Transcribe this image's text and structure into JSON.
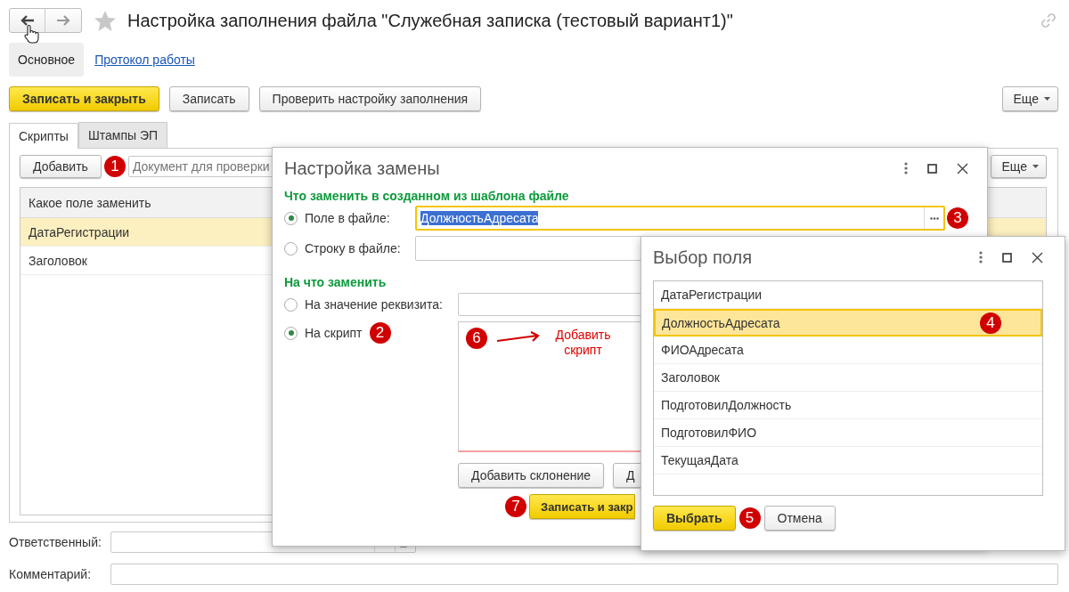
{
  "window": {
    "title": "Настройка заполнения файла \"Служебная записка (тестовый вариант1)\""
  },
  "sections": [
    {
      "label": "Основное",
      "selected": true
    },
    {
      "label": "Протокол работы",
      "selected": false
    }
  ],
  "command_bar": {
    "buttons": [
      {
        "label": "Записать и закрыть",
        "kind": "primary"
      },
      {
        "label": "Записать",
        "kind": "normal"
      },
      {
        "label": "Проверить настройку заполнения",
        "kind": "normal"
      }
    ],
    "more": "Еще"
  },
  "tabs": [
    {
      "label": "Скрипты",
      "selected": true
    },
    {
      "label": "Штампы ЭП",
      "selected": false
    }
  ],
  "scripts_toolbar": {
    "add_button": "Добавить",
    "callout": "1",
    "document_field": {
      "placeholder": "Документ для проверки"
    },
    "more": "Еще"
  },
  "scripts_table": {
    "columns": [
      "Какое поле заменить"
    ],
    "rows": [
      {
        "cells": [
          "ДатаРегистрации"
        ],
        "selected": true
      },
      {
        "cells": [
          "Заголовок"
        ],
        "selected": false
      }
    ]
  },
  "responsible": {
    "label": "Ответственный:"
  },
  "comment": {
    "label": "Комментарий:"
  },
  "replace_dialog": {
    "title": "Настройка замены",
    "what_header": "Что заменить в созданном из шаблона файле",
    "what_options": [
      {
        "label": "Поле в файле:",
        "selected": true,
        "value": "ДолжностьАдресата",
        "callout": "3"
      },
      {
        "label": "Строку в файле:",
        "selected": false
      }
    ],
    "with_header": "На что заменить",
    "with_options": [
      {
        "label": "На значение реквизита:",
        "selected": false
      },
      {
        "label": "На скрипт",
        "selected": true,
        "callout": "2"
      }
    ],
    "script_note": {
      "callout": "6",
      "text": "Добавить скрипт"
    },
    "script_buttons": [
      "Добавить склонение",
      "Д"
    ],
    "save_button": "Записать и закр",
    "save_callout": "7"
  },
  "field_picker": {
    "title": "Выбор поля",
    "items": [
      {
        "label": "ДатаРегистрации",
        "selected": false
      },
      {
        "label": "ДолжностьАдресата",
        "selected": true,
        "callout": "4"
      },
      {
        "label": "ФИОАдресата",
        "selected": false
      },
      {
        "label": "Заголовок",
        "selected": false
      },
      {
        "label": "ПодготовилДолжность",
        "selected": false
      },
      {
        "label": "ПодготовилФИО",
        "selected": false
      },
      {
        "label": "ТекущаяДата",
        "selected": false
      }
    ],
    "buttons": [
      {
        "label": "Выбрать",
        "kind": "primary",
        "callout": "5"
      },
      {
        "label": "Отмена",
        "kind": "normal"
      }
    ]
  }
}
